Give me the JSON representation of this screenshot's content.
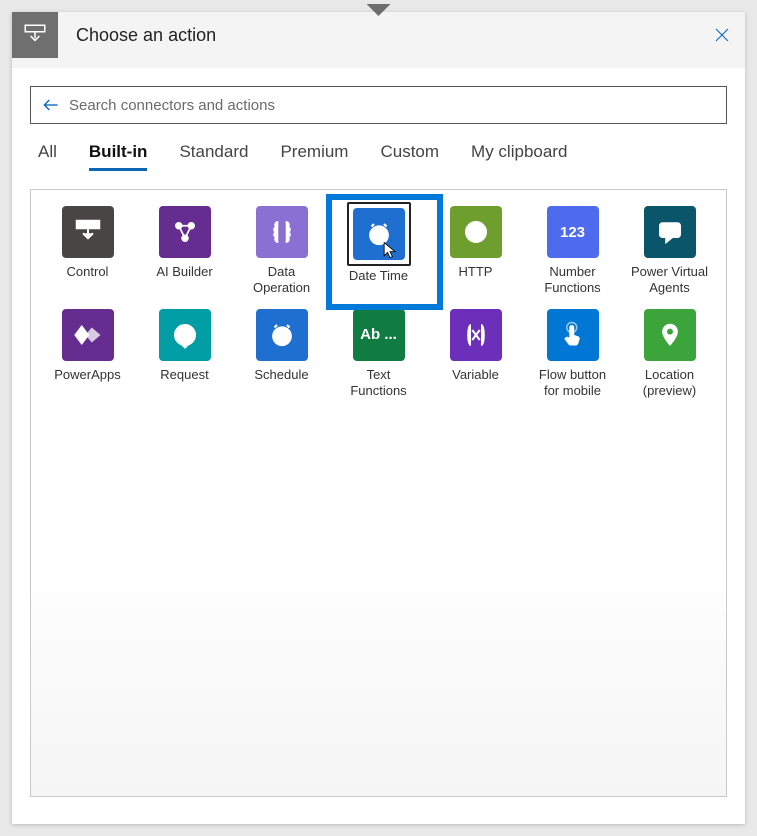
{
  "header": {
    "title": "Choose an action"
  },
  "search": {
    "placeholder": "Search connectors and actions"
  },
  "tabs": [
    {
      "label": "All",
      "active": false
    },
    {
      "label": "Built-in",
      "active": true
    },
    {
      "label": "Standard",
      "active": false
    },
    {
      "label": "Premium",
      "active": false
    },
    {
      "label": "Custom",
      "active": false
    },
    {
      "label": "My clipboard",
      "active": false
    }
  ],
  "connectors": [
    {
      "label": "Control",
      "color": "#484644",
      "icon": "control"
    },
    {
      "label": "AI Builder",
      "color": "#652D90",
      "icon": "aibuilder"
    },
    {
      "label": "Data Operation",
      "color": "#8B70D4",
      "icon": "dataop"
    },
    {
      "label": "Date Time",
      "color": "#1F6FD0",
      "icon": "clock",
      "highlighted": true
    },
    {
      "label": "HTTP",
      "color": "#6E9E2D",
      "icon": "globe"
    },
    {
      "label": "Number Functions",
      "color": "#4F6BED",
      "icon": "num",
      "text": "123"
    },
    {
      "label": "Power Virtual Agents",
      "color": "#0B556A",
      "icon": "pva"
    },
    {
      "label": "PowerApps",
      "color": "#652D90",
      "icon": "powerapps"
    },
    {
      "label": "Request",
      "color": "#009DA5",
      "icon": "request"
    },
    {
      "label": "Schedule",
      "color": "#1F6FD0",
      "icon": "clock"
    },
    {
      "label": "Text Functions",
      "color": "#107C41",
      "icon": "text",
      "text": "Ab ..."
    },
    {
      "label": "Variable",
      "color": "#6B2FBA",
      "icon": "var"
    },
    {
      "label": "Flow button for mobile",
      "color": "#0077D4",
      "icon": "touch"
    },
    {
      "label": "Location (preview)",
      "color": "#3BA53B",
      "icon": "pin"
    }
  ]
}
